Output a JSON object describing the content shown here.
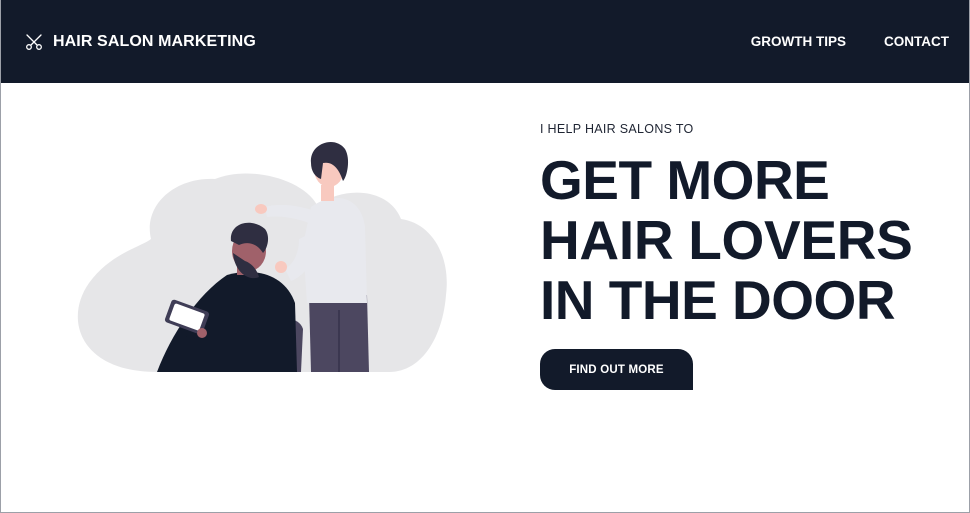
{
  "navbar": {
    "brand_icon": "scissors-icon",
    "brand_name": "HAIR SALON MARKETING",
    "links": [
      {
        "label": "GROWTH TIPS"
      },
      {
        "label": "CONTACT"
      }
    ]
  },
  "hero": {
    "kicker": "I HELP HAIR SALONS TO",
    "headline": {
      "line1": "GET MORE",
      "line2": "HAIR LOVERS",
      "line3": "IN THE DOOR"
    },
    "cta_label": "FIND OUT MORE",
    "illustration": "barber-cutting-hair-illustration"
  },
  "colors": {
    "navy": "#121a2a",
    "cloud": "#e6e6e8",
    "skin": "#f8c9bf",
    "dark_skin": "#a0616a",
    "hair": "#2f2e41",
    "pants": "#4c4760",
    "shirt": "#e8e9ee"
  }
}
